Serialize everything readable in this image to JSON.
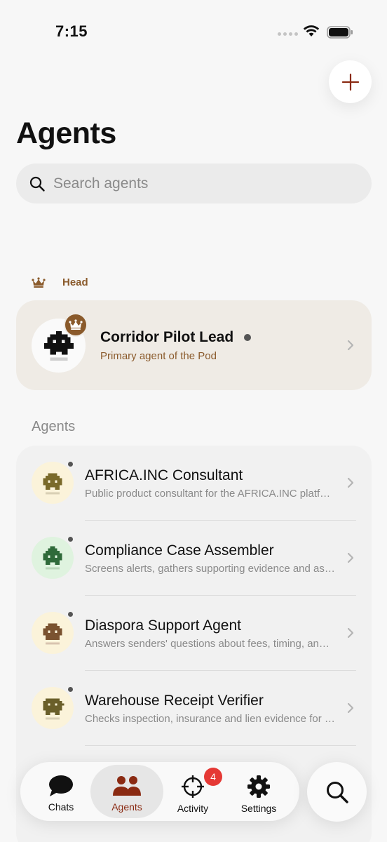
{
  "status_bar": {
    "time": "7:15"
  },
  "header": {
    "title": "Agents",
    "add_icon": "plus-icon"
  },
  "search": {
    "placeholder": "Search agents"
  },
  "head_section": {
    "label": "Head",
    "agent": {
      "name": "Corridor Pilot Lead",
      "subtitle": "Primary agent of the Pod",
      "status": "offline"
    }
  },
  "agents_section": {
    "label": "Agents",
    "items": [
      {
        "name": "AFRICA.INC Consultant",
        "description": "Public product consultant for the AFRICA.INC platform",
        "avatar_color": "#7a6a2a",
        "avatar_bg": "#fbf3da"
      },
      {
        "name": "Compliance Case Assembler",
        "description": "Screens alerts, gathers supporting evidence and assembles cases",
        "avatar_color": "#2f6a3a",
        "avatar_bg": "#dff3df"
      },
      {
        "name": "Diaspora Support Agent",
        "description": "Answers senders' questions about fees, timing, and transfers",
        "avatar_color": "#7a5230",
        "avatar_bg": "#fbf3da"
      },
      {
        "name": "Warehouse Receipt Verifier",
        "description": "Checks inspection, insurance and lien evidence for receipts",
        "avatar_color": "#6a5f2a",
        "avatar_bg": "#fbf3da"
      }
    ]
  },
  "tab_bar": {
    "tabs": [
      {
        "label": "Chats",
        "icon": "chat-bubble-icon",
        "active": false
      },
      {
        "label": "Agents",
        "icon": "people-icon",
        "active": true
      },
      {
        "label": "Activity",
        "icon": "crosshair-icon",
        "active": false,
        "badge": "4"
      },
      {
        "label": "Settings",
        "icon": "gear-icon",
        "active": false
      }
    ],
    "search_icon": "search-icon"
  },
  "colors": {
    "accent": "#8a2a12",
    "head_accent": "#8a5a2b",
    "badge": "#e53935"
  }
}
